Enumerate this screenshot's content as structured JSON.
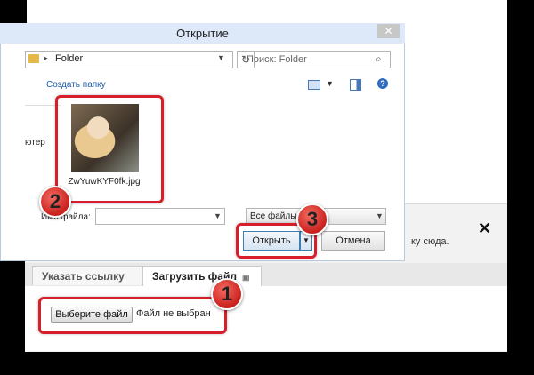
{
  "webpage": {
    "upload_hint": "ку сюда.",
    "close_label": "✕",
    "tabs": [
      {
        "label": "Указать ссылку"
      },
      {
        "label": "Загрузить файл"
      }
    ],
    "choose_file_label": "Выберите файл",
    "no_file_text": "Файл не выбран"
  },
  "dialog": {
    "title": "Открытие",
    "close_label": "✕",
    "address": {
      "path": "Folder",
      "arrow": "▸"
    },
    "search_placeholder": "Поиск: Folder",
    "new_folder_label": "Создать папку",
    "help_label": "?",
    "nav_item": "ютер",
    "file": {
      "name": "ZwYuwKYF0fk.jpg"
    },
    "filename_label": "Имя файла:",
    "filter_value": "Все файлы",
    "open_label": "Открыть",
    "cancel_label": "Отмена"
  },
  "annotations": [
    "1",
    "2",
    "3"
  ],
  "colors": {
    "highlight": "#d61f2a",
    "marker": "#c9211e"
  }
}
